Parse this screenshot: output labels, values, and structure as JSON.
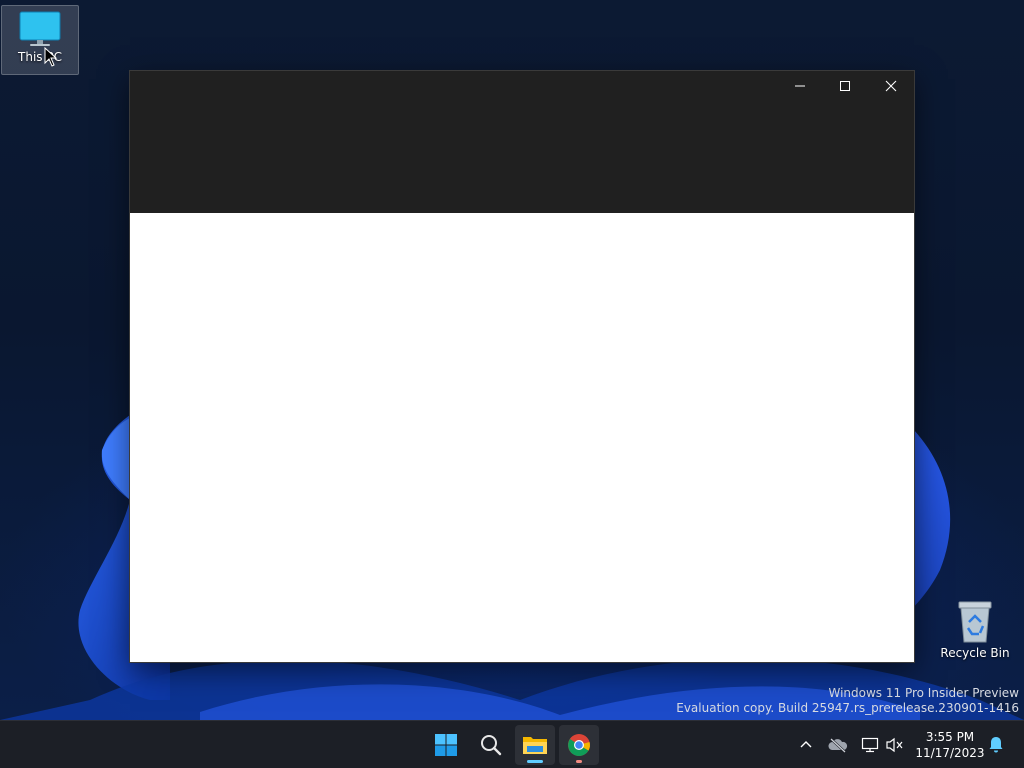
{
  "desktop": {
    "icons": {
      "this_pc": {
        "label": "This PC",
        "icon": "monitor-icon"
      },
      "recycle_bin": {
        "label": "Recycle Bin",
        "icon": "recycle-bin-icon"
      }
    },
    "watermark": {
      "line1": "Windows 11 Pro Insider Preview",
      "line2": "Evaluation copy. Build 25947.rs_prerelease.230901-1416"
    }
  },
  "window": {
    "caption_buttons": [
      "minimize-icon",
      "maximize-icon",
      "close-icon"
    ]
  },
  "taskbar": {
    "apps": [
      "windows-logo-icon",
      "search-icon",
      "file-explorer-icon",
      "chrome-icon"
    ],
    "tray": [
      "chevron-up-icon",
      "onedrive-offline-icon",
      "network-icon",
      "volume-muted-icon",
      "notification-bell-icon"
    ],
    "clock": {
      "time": "3:55 PM",
      "date": "11/17/2023"
    }
  },
  "colors": {
    "taskbar_bg": "#1c1f26",
    "titlebar_bg": "#202020",
    "accent": "#60cdff",
    "chrome_indicator": "#f28b82"
  }
}
